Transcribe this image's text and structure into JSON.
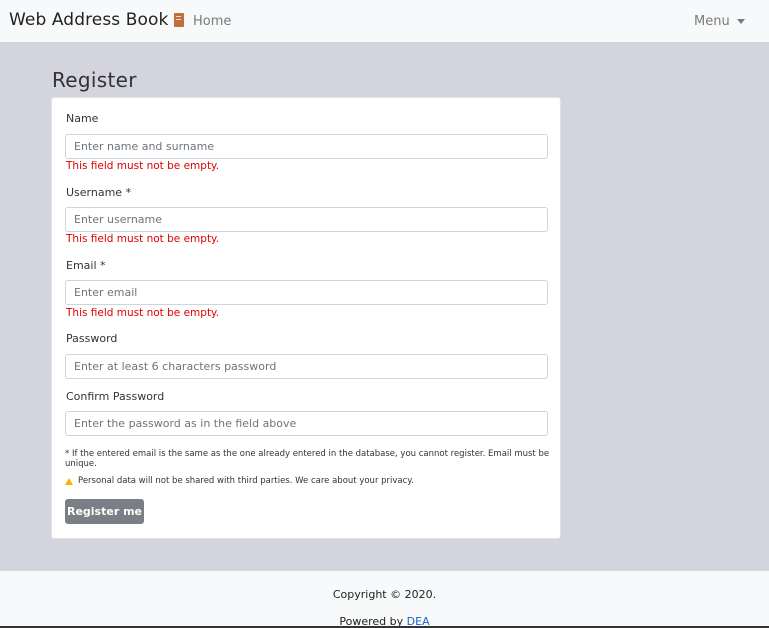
{
  "navbar": {
    "brand": "Web Address Book",
    "brand_icon": "book-icon",
    "home": "Home",
    "menu": "Menu"
  },
  "page": {
    "title": "Register"
  },
  "form": {
    "name": {
      "label": "Name",
      "placeholder": "Enter name and surname",
      "value": "",
      "error": "This field must not be empty."
    },
    "username": {
      "label": "Username *",
      "placeholder": "Enter username",
      "value": "",
      "error": "This field must not be empty."
    },
    "email": {
      "label": "Email *",
      "placeholder": "Enter email",
      "value": "",
      "error": "This field must not be empty."
    },
    "password": {
      "label": "Password",
      "placeholder": "Enter at least 6 characters password",
      "value": ""
    },
    "confirm_password": {
      "label": "Confirm Password",
      "placeholder": "Enter the password as in the field above",
      "value": ""
    },
    "note_email": "* If the entered email is the same as the one already entered in the database, you cannot register. Email must be unique.",
    "note_privacy": "Personal data will not be shared with third parties. We care about your privacy.",
    "submit": "Register me"
  },
  "footer": {
    "copyright": "Copyright © 2020.",
    "powered_prefix": "Powered by ",
    "powered_link": "DEA"
  },
  "colors": {
    "background": "#d4d4df",
    "error": "#e00000",
    "button": "#7c7e85",
    "link": "#1a63c7"
  }
}
